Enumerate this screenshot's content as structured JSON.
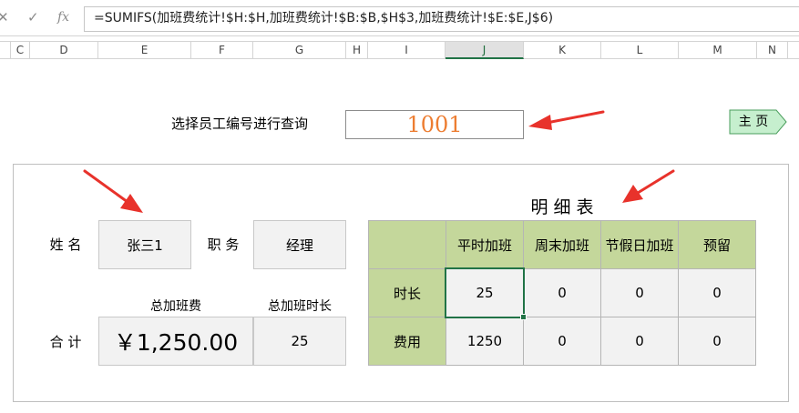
{
  "formula_bar": {
    "cancel_icon": "✕",
    "confirm_icon": "✓",
    "fx_label": "fx",
    "formula": "=SUMIFS(加班费统计!$H:$H,加班费统计!$B:$B,$H$3,加班费统计!$E:$E,J$6)"
  },
  "columns": [
    "C",
    "D",
    "E",
    "F",
    "G",
    "H",
    "I",
    "J",
    "K",
    "L",
    "M",
    "N"
  ],
  "active_column": "J",
  "query": {
    "label": "选择员工编号进行查询",
    "value": "1001",
    "value_color": "#ed7d31"
  },
  "home_button": {
    "label": "主 页"
  },
  "employee": {
    "name_label": "姓 名",
    "name_value": "张三1",
    "position_label": "职 务",
    "position_value": "经理"
  },
  "totals": {
    "total_label": "合 计",
    "overtime_pay_header": "总加班费",
    "overtime_pay_value": "￥1,250.00",
    "overtime_hours_header": "总加班时长",
    "overtime_hours_value": "25"
  },
  "detail_table": {
    "title": "明细表",
    "headers": [
      "",
      "平时加班",
      "周末加班",
      "节假日加班",
      "预留"
    ],
    "rows": [
      {
        "label": "时长",
        "values": [
          "25",
          "0",
          "0",
          "0"
        ]
      },
      {
        "label": "费用",
        "values": [
          "1250",
          "0",
          "0",
          "0"
        ]
      }
    ],
    "header_color": "#c4d79b"
  },
  "colors": {
    "arrow": "#e8322b",
    "selection": "#217346"
  }
}
